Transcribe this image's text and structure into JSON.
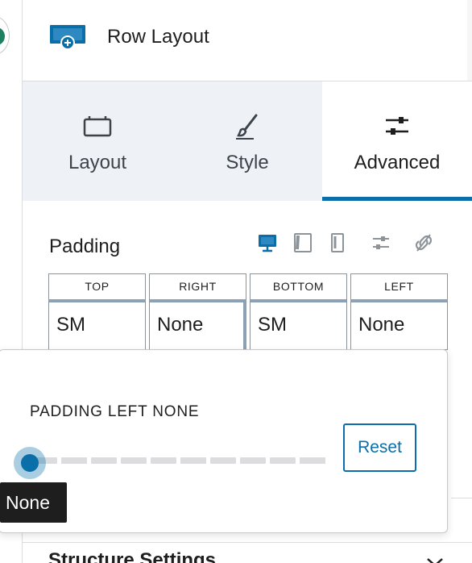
{
  "header": {
    "title": "Row Layout",
    "icon": "row-layout-icon"
  },
  "tabs": [
    {
      "label": "Layout",
      "icon": "layout-icon",
      "active": false
    },
    {
      "label": "Style",
      "icon": "brush-icon",
      "active": false
    },
    {
      "label": "Advanced",
      "icon": "sliders-icon",
      "active": true
    }
  ],
  "padding": {
    "label": "Padding",
    "device_icons": [
      "desktop-icon",
      "tablet-icon",
      "mobile-icon",
      "sliders-icon",
      "unlink-icon"
    ],
    "cells": [
      {
        "heading": "TOP",
        "value": "SM"
      },
      {
        "heading": "RIGHT",
        "value": "None"
      },
      {
        "heading": "BOTTOM",
        "value": "SM"
      },
      {
        "heading": "LEFT",
        "value": "None"
      }
    ]
  },
  "popover": {
    "title": "PADDING LEFT NONE",
    "slider_level": 0,
    "reset_label": "Reset",
    "tooltip": "None"
  },
  "structure": {
    "label": "Structure Settings"
  },
  "colors": {
    "accent": "#0a6fa8",
    "tab_bg": "#eef2f6",
    "text": "#1e1e1e"
  }
}
